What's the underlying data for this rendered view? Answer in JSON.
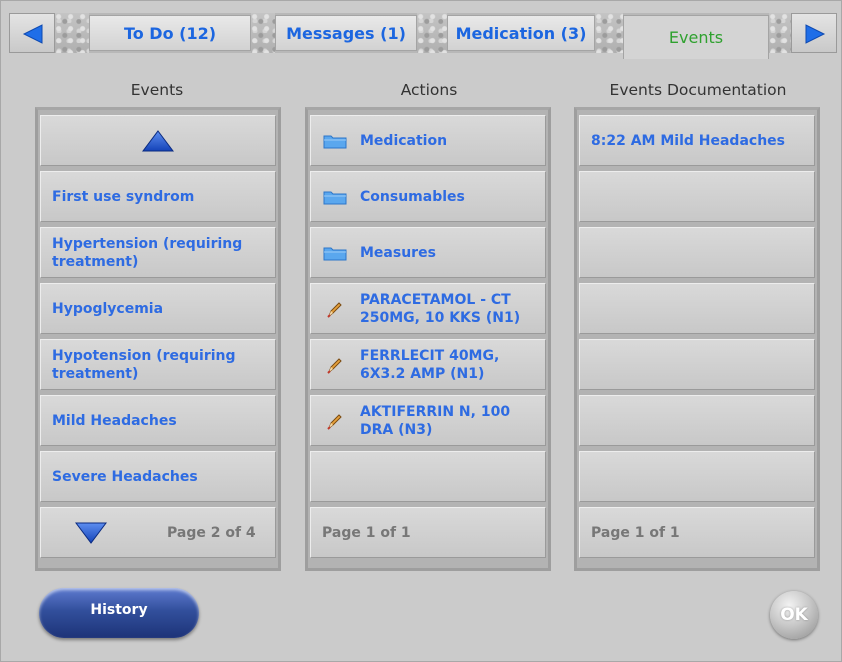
{
  "tabs": [
    {
      "label": "To Do (12)"
    },
    {
      "label": "Messages (1)"
    },
    {
      "label": "Medication (3)"
    },
    {
      "label": "Events"
    }
  ],
  "colors": {
    "tab_text": "#1c66e0",
    "active_tab_text": "#2fa12f",
    "item_text": "#2e6be2"
  },
  "events": {
    "header": "Events",
    "items": [
      {
        "label": "First use syndrom"
      },
      {
        "label": "Hypertension (requiring treatment)"
      },
      {
        "label": "Hypoglycemia"
      },
      {
        "label": "Hypotension (requiring treatment)"
      },
      {
        "label": "Mild Headaches"
      },
      {
        "label": "Severe Headaches"
      }
    ],
    "page": "Page 2 of 4"
  },
  "actions": {
    "header": "Actions",
    "items": [
      {
        "label": "Medication",
        "icon": "folder-icon"
      },
      {
        "label": "Consumables",
        "icon": "folder-icon"
      },
      {
        "label": "Measures",
        "icon": "folder-icon"
      },
      {
        "label": "PARACETAMOL - CT 250MG, 10 KKS (N1)",
        "icon": "pencil-icon"
      },
      {
        "label": "FERRLECIT 40MG, 6X3.2 AMP (N1)",
        "icon": "pencil-icon"
      },
      {
        "label": "AKTIFERRIN N, 100 DRA (N3)",
        "icon": "pencil-icon"
      }
    ],
    "page": "Page 1 of 1"
  },
  "documentation": {
    "header": "Events Documentation",
    "items": [
      {
        "label": "8:22 AM Mild Headaches"
      }
    ],
    "page": "Page 1 of 1"
  },
  "buttons": {
    "history": "History",
    "ok": "OK"
  }
}
